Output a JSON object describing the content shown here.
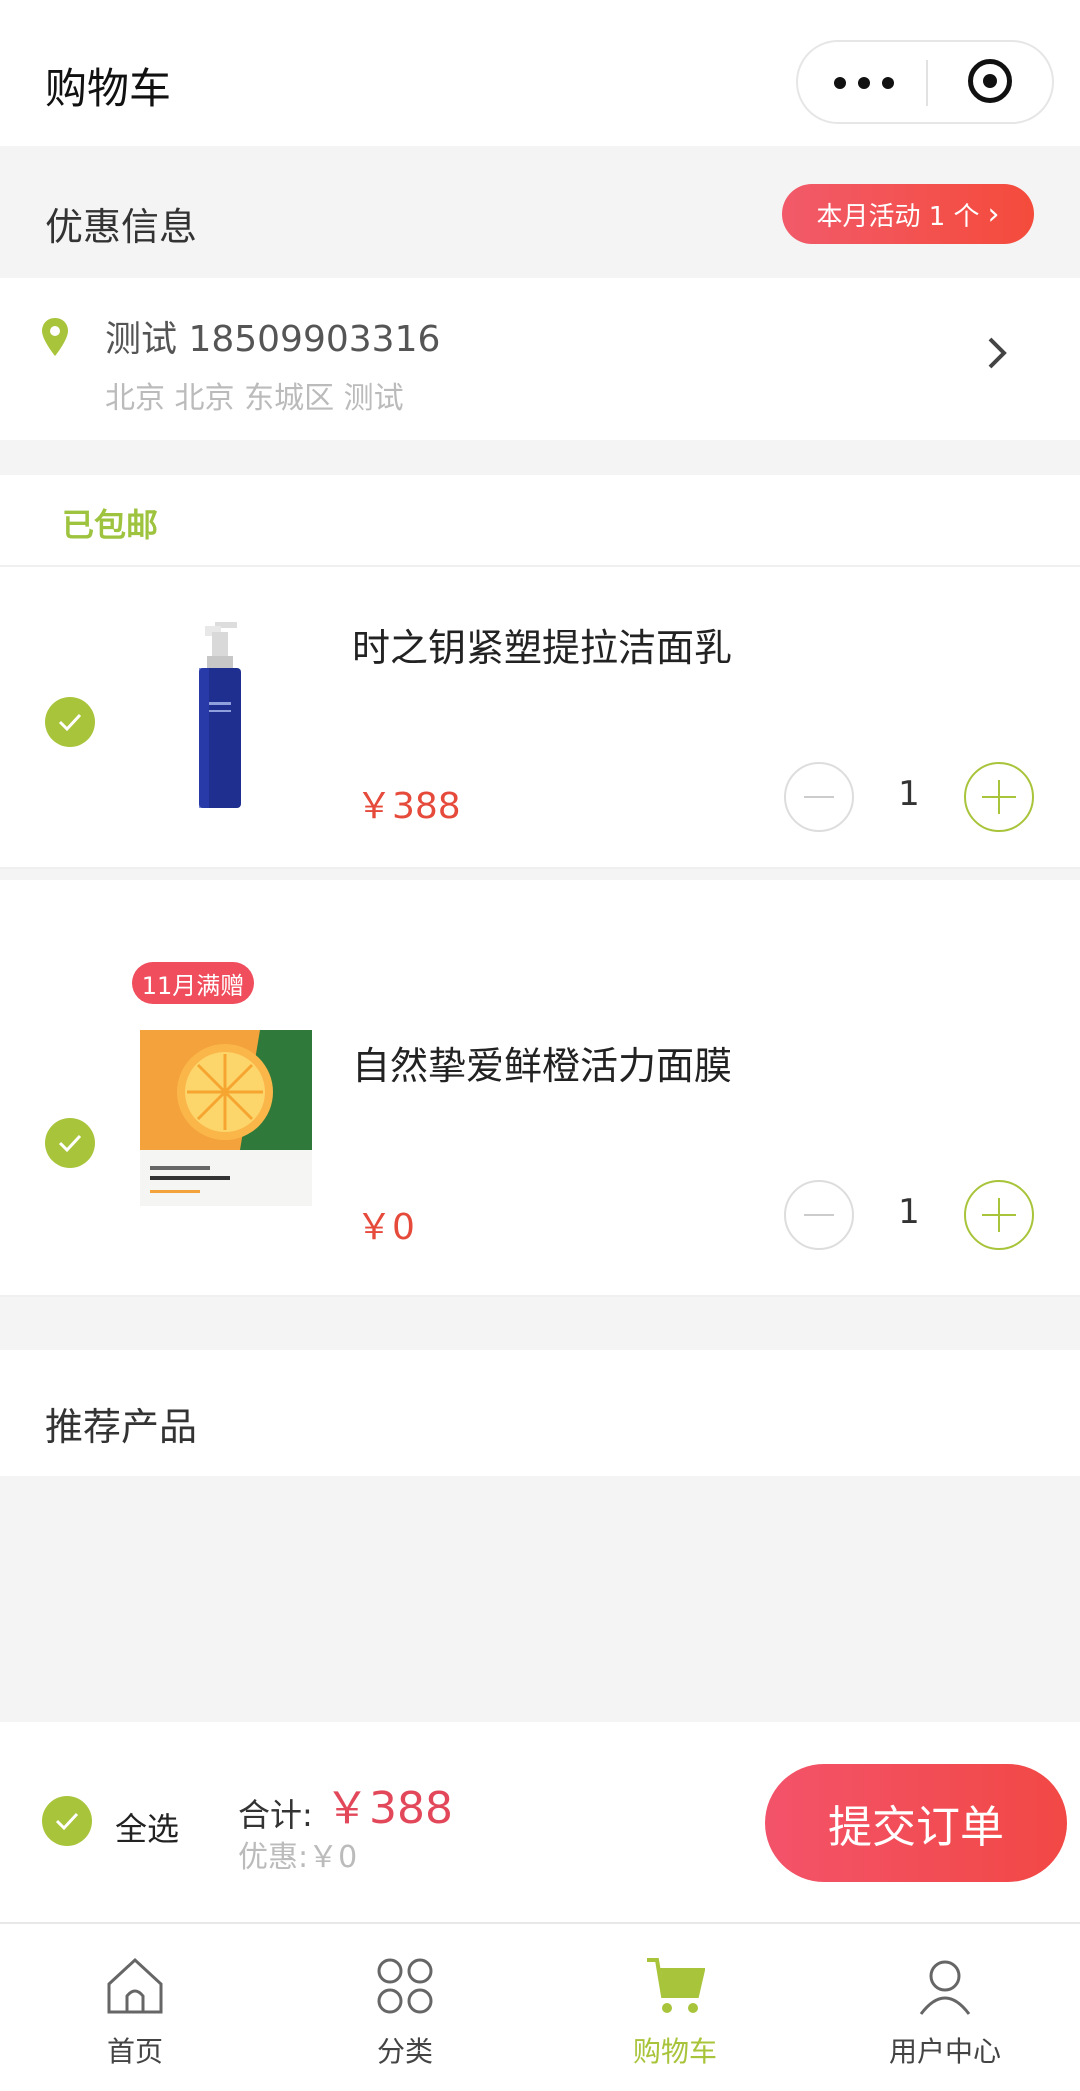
{
  "header": {
    "title": "购物车"
  },
  "promo": {
    "label": "优惠信息",
    "activity": "本月活动 1 个"
  },
  "address": {
    "name_phone": "测试 18509903316",
    "detail": "北京 北京 东城区 测试"
  },
  "shipping": {
    "label": "已包邮"
  },
  "items": [
    {
      "name": "时之钥紧塑提拉洁面乳",
      "price": "￥388",
      "qty": "1"
    },
    {
      "name": "自然挚爱鲜橙活力面膜",
      "price": "￥0",
      "qty": "1",
      "badge": "11月满赠"
    }
  ],
  "recommend": {
    "title": "推荐产品"
  },
  "summary": {
    "select_all": "全选",
    "total_label": "合计:",
    "total_amount": "￥388",
    "discount": "优惠:￥0",
    "submit": "提交订单"
  },
  "tabbar": [
    {
      "label": "首页",
      "icon": "home-icon"
    },
    {
      "label": "分类",
      "icon": "category-icon"
    },
    {
      "label": "购物车",
      "icon": "cart-icon",
      "active": true
    },
    {
      "label": "用户中心",
      "icon": "user-icon"
    }
  ],
  "colors": {
    "accent_green": "#a8c43a",
    "price_red": "#e64a3b",
    "promo_red": "#f24845"
  }
}
